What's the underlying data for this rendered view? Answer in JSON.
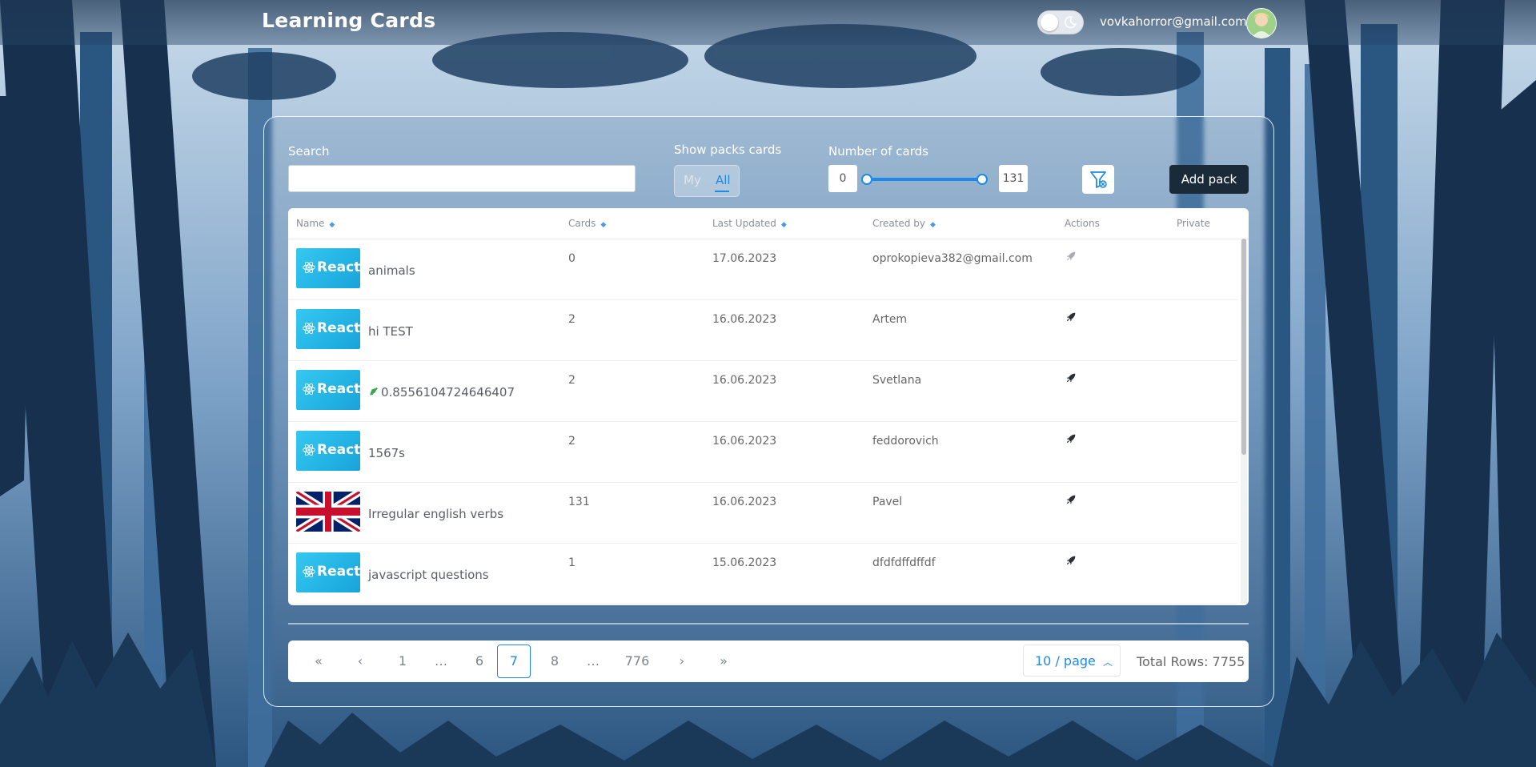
{
  "header": {
    "title": "Learning Cards",
    "user_email": "vovkahorror@gmail.com"
  },
  "filters": {
    "search_label": "Search",
    "search_value": "",
    "show_packs_label": "Show packs cards",
    "show_packs_options": [
      "My",
      "All"
    ],
    "show_packs_selected": "All",
    "number_label": "Number of cards",
    "min": "0",
    "max": "131",
    "add_pack_label": "Add pack"
  },
  "table": {
    "columns": [
      "Name",
      "Cards",
      "Last Updated",
      "Created by",
      "Actions",
      "Private"
    ],
    "rows": [
      {
        "cover": "react",
        "cover_text": "React",
        "name": "animals",
        "cards": "0",
        "updated": "17.06.2023",
        "created_by": "oprokopieva382@gmail.com",
        "action_disabled": true
      },
      {
        "cover": "react",
        "cover_text": "React",
        "name": "hi TEST",
        "cards": "2",
        "updated": "16.06.2023",
        "created_by": "Artem",
        "action_disabled": false
      },
      {
        "cover": "react",
        "cover_text": "React",
        "name": "0.8556104724646407",
        "name_icon": "dinosaur-icon",
        "cards": "2",
        "updated": "16.06.2023",
        "created_by": "Svetlana",
        "action_disabled": false
      },
      {
        "cover": "react",
        "cover_text": "React",
        "name": "1567s",
        "cards": "2",
        "updated": "16.06.2023",
        "created_by": "feddorovich",
        "action_disabled": false
      },
      {
        "cover": "uk-flag",
        "name": "Irregular english verbs",
        "cards": "131",
        "updated": "16.06.2023",
        "created_by": "Pavel",
        "action_disabled": false
      },
      {
        "cover": "react",
        "cover_text": "React",
        "name": "javascript questions",
        "cards": "1",
        "updated": "15.06.2023",
        "created_by": "dfdfdffdffdf",
        "action_disabled": false
      }
    ]
  },
  "pagination": {
    "pages": [
      "1",
      "…",
      "6",
      "7",
      "8",
      "…",
      "776"
    ],
    "current": "7",
    "per_page": "10 / page",
    "total_rows": "Total Rows: 7755"
  },
  "colors": {
    "accent": "#1e8ae6",
    "add_button": "#1b2a38",
    "react_cover": "#22b3e4"
  }
}
